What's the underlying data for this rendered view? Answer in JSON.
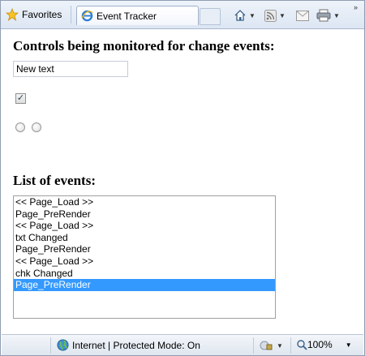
{
  "browser": {
    "favorites_label": "Favorites",
    "tab_title": "Event Tracker",
    "icons": [
      "star-icon",
      "ie-icon",
      "home-icon",
      "rss-icon",
      "mail-icon",
      "print-icon",
      "chevron-double-icon"
    ]
  },
  "page": {
    "heading_controls": "Controls being monitored for change events:",
    "textbox_value": "New text",
    "checkbox_checked": true,
    "checkbox_glyph": "✓",
    "radio_count": 2,
    "heading_events": "List of events:",
    "events": [
      "<< Page_Load >>",
      "Page_PreRender",
      "<< Page_Load >>",
      "txt Changed",
      "Page_PreRender",
      "<< Page_Load >>",
      "chk Changed",
      "Page_PreRender"
    ],
    "selected_event_index": 7
  },
  "status": {
    "zone_text": "Internet | Protected Mode: On",
    "zoom_text": "100%"
  },
  "colors": {
    "selection": "#3399ff",
    "chrome_border": "#8f9db0"
  }
}
